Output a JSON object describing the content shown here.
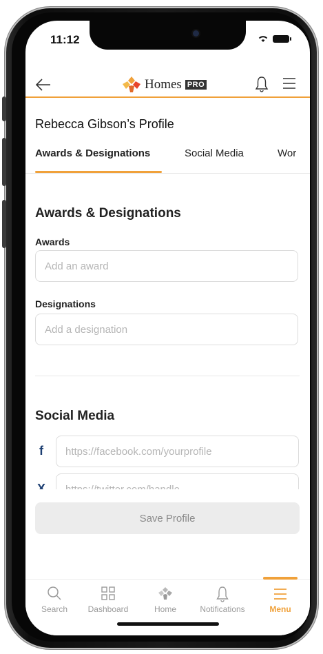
{
  "status_bar": {
    "time": "11:12"
  },
  "header": {
    "logo_text": "Homes",
    "logo_badge": "PRO"
  },
  "page": {
    "title": "Rebecca Gibson’s Profile"
  },
  "tabs": [
    {
      "label": "Awards & Designations",
      "active": true
    },
    {
      "label": "Social Media",
      "active": false
    },
    {
      "label": "Wor",
      "active": false
    }
  ],
  "awards_section": {
    "title": "Awards & Designations",
    "awards_label": "Awards",
    "awards_placeholder": "Add an award",
    "designations_label": "Designations",
    "designations_placeholder": "Add a designation"
  },
  "social_section": {
    "title": "Social Media",
    "facebook_placeholder": "https://facebook.com/yourprofile",
    "twitter_placeholder": "https://twitter.com/handle"
  },
  "actions": {
    "save_label": "Save Profile"
  },
  "bottom_nav": [
    {
      "label": "Search",
      "icon": "search-icon",
      "active": false
    },
    {
      "label": "Dashboard",
      "icon": "dashboard-icon",
      "active": false
    },
    {
      "label": "Home",
      "icon": "home-logo-icon",
      "active": false
    },
    {
      "label": "Notifications",
      "icon": "bell-icon",
      "active": false
    },
    {
      "label": "Menu",
      "icon": "menu-icon",
      "active": true
    }
  ],
  "colors": {
    "accent": "#f0a13a",
    "facebook": "#1d3f72"
  }
}
